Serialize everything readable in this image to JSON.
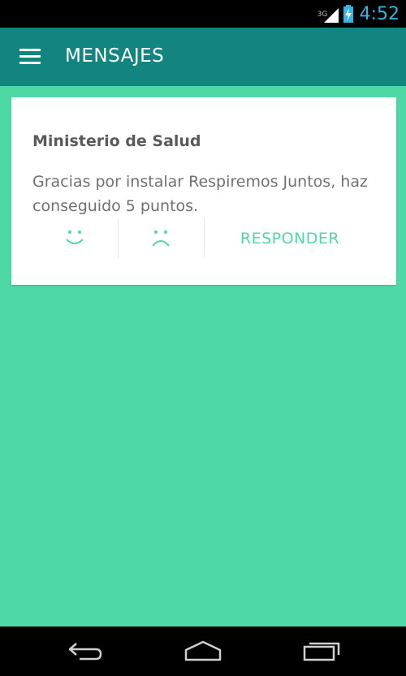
{
  "status_bar": {
    "network": "3G",
    "time": "4:52",
    "icons": [
      "signal-icon",
      "battery-charging-icon"
    ]
  },
  "app_bar": {
    "menu_icon": "hamburger-menu-icon",
    "title": "MENSAJES"
  },
  "messages": [
    {
      "sender": "Ministerio de Salud",
      "body": "Gracias por instalar Respiremos Juntos, haz conseguido 5 puntos.",
      "actions": {
        "like_icon": "happy-face-icon",
        "dislike_icon": "sad-face-icon",
        "reply_label": "RESPONDER"
      }
    }
  ],
  "nav_bar": {
    "icons": [
      "back-icon",
      "home-icon",
      "recent-apps-icon"
    ]
  },
  "colors": {
    "app_bar": "#12857f",
    "background": "#4dd8a6",
    "accent": "#4dd8a6",
    "clock": "#33b5e5"
  }
}
